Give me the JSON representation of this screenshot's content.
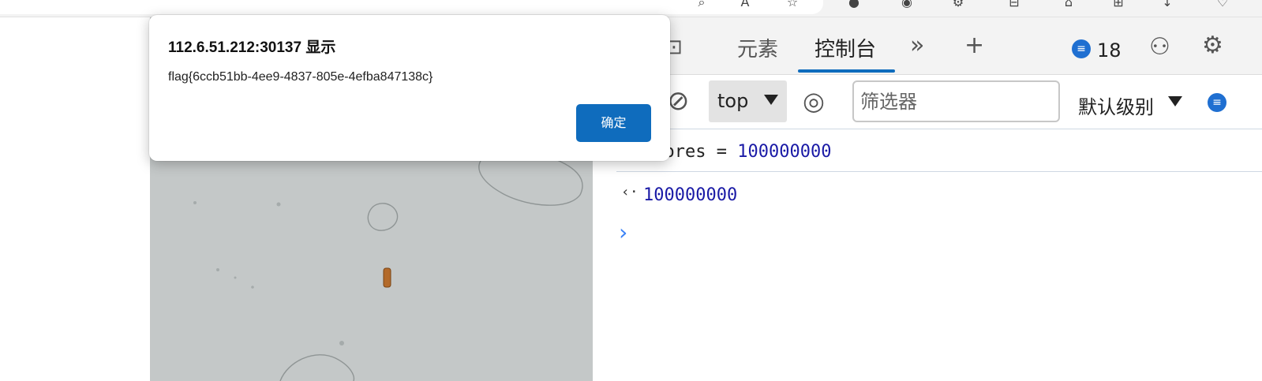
{
  "dialog": {
    "title": "112.6.51.212:30137 显示",
    "message": "flag{6ccb51bb-4ee9-4837-805e-4efba847138c}",
    "ok_label": "确定"
  },
  "devtools": {
    "tabs": [
      {
        "label": "元素",
        "active": false
      },
      {
        "label": "控制台",
        "active": true
      }
    ],
    "issue_count": "18",
    "context_selector": "top",
    "filter_placeholder": "筛选器",
    "log_level": "默认级别",
    "console": {
      "input_keyword": "scores",
      "input_op": " = ",
      "input_value": "100000000",
      "output_value": "100000000"
    },
    "colors": {
      "accent": "#0f6cbd",
      "number": "#1a1aa6",
      "prompt": "#3b82f6"
    }
  }
}
